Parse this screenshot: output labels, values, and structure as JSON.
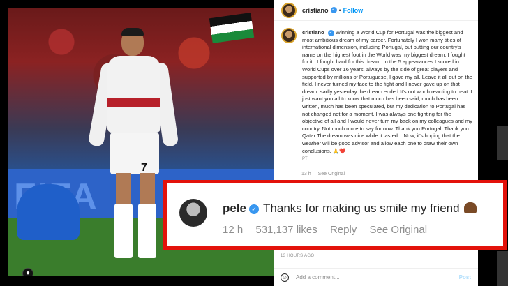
{
  "post": {
    "username": "cristiano",
    "follow_label": "Follow",
    "caption_username": "cristiano",
    "caption": "Winning a World Cup for Portugal was the biggest and most ambitious dream of my career. Fortunately I won many titles of international dimension, including Portugal, but putting our country's name on the highest foot in the World was my biggest dream. I fought for it . I fought hard for this dream. In the 5 appearances I scored in World Cups over 16 years, always by the side of great players and supported by millions of Portuguese, I gave my all. Leave it all out on the field. I never turned my face to the fight and I never gave up on that dream. sadly yesterday the dream ended It's not worth reacting to heat. I just want you all to know that much has been said, much has been written, much has been speculated, but my dedication to Portugal has not changed not for a moment. I was always one fighting for the objective of all and I would never turn my back on my colleagues and my country. Not much more to say for now. Thank you Portugal. Thank you Qatar The dream was nice while it lasted... Now, it's hoping that the weather will be good advisor and allow each one to draw their own conclusions. 🙏❤️",
    "caption_translation_tag": "PT",
    "caption_time": "13 h",
    "caption_see_original": "See Original",
    "timestamp": "13 HOURS AGO",
    "add_comment_placeholder": "Add a comment...",
    "post_label": "Post"
  },
  "photo": {
    "jersey_number": "7"
  },
  "highlight_comment": {
    "username": "pele",
    "text": "Thanks for making us smile my friend",
    "time": "12 h",
    "likes": "531,137 likes",
    "reply": "Reply",
    "see_original": "See Original",
    "border_color": "#e3120b"
  },
  "colors": {
    "link_blue": "#0095f6",
    "verified_blue": "#3897f0",
    "muted_gray": "#8e8e8e"
  }
}
